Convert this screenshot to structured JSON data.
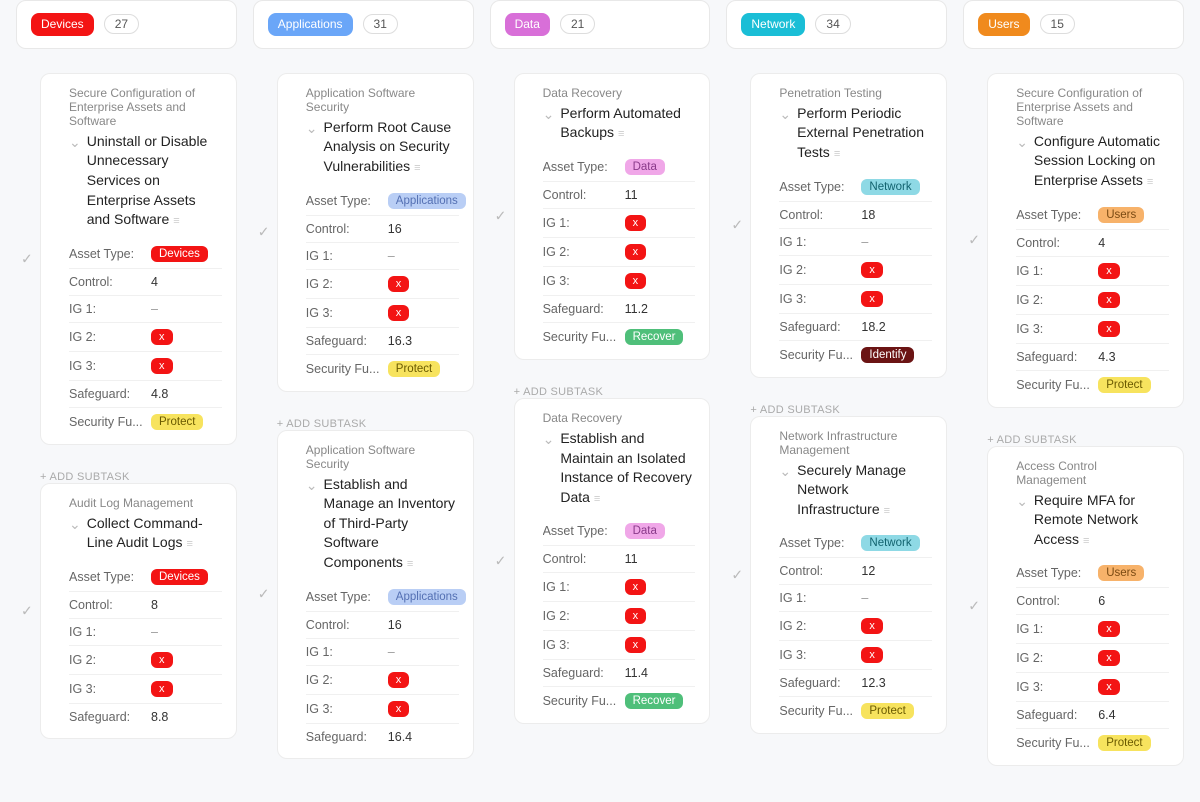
{
  "ui": {
    "add_subtask": "+ ADD SUBTASK"
  },
  "labels": {
    "asset_type": "Asset Type:",
    "control": "Control:",
    "ig1": "IG 1:",
    "ig2": "IG 2:",
    "ig3": "IG 3:",
    "safeguard": "Safeguard:",
    "security_fu": "Security Fu..."
  },
  "badge_x": "x",
  "dash": "–",
  "asset_type_colors": {
    "Devices": "t-devices",
    "Applications": "t-apps",
    "Data": "t-data",
    "Network": "t-network",
    "Users": "t-users"
  },
  "sec_fu_colors": {
    "Protect": "t-protect",
    "Recover": "t-recover",
    "Identify": "t-identify"
  },
  "columns": [
    {
      "name": "Devices",
      "count": "27",
      "bar": "c-devices",
      "pill": "c-devices",
      "cards": [
        {
          "category": "Secure Configuration of Enterprise Assets and Software",
          "title": "Uninstall or Disable Unnecessary Services on Enterprise Assets and Software",
          "asset_type": "Devices",
          "control": "4",
          "ig1": "–",
          "ig2": "x",
          "ig3": "x",
          "safeguard": "4.8",
          "sec_fu": "Protect",
          "show_add": true
        },
        {
          "category": "Audit Log Management",
          "title": "Collect Command-Line Audit Logs",
          "asset_type": "Devices",
          "control": "8",
          "ig1": "–",
          "ig2": "x",
          "ig3": "x",
          "safeguard": "8.8",
          "sec_fu": ""
        }
      ]
    },
    {
      "name": "Applications",
      "count": "31",
      "bar": "c-apps",
      "pill": "c-apps",
      "cards": [
        {
          "category": "Application Software Security",
          "title": "Perform Root Cause Analysis on Security Vulnerabilities",
          "asset_type": "Applications",
          "control": "16",
          "ig1": "–",
          "ig2": "x",
          "ig3": "x",
          "safeguard": "16.3",
          "sec_fu": "Protect",
          "show_add": true
        },
        {
          "category": "Application Software Security",
          "title": "Establish and Manage an Inventory of Third-Party Software Components",
          "asset_type": "Applications",
          "control": "16",
          "ig1": "–",
          "ig2": "x",
          "ig3": "x",
          "safeguard": "16.4",
          "sec_fu": ""
        }
      ]
    },
    {
      "name": "Data",
      "count": "21",
      "bar": "c-data",
      "pill": "c-data",
      "cards": [
        {
          "category": "Data Recovery",
          "title": "Perform Automated Backups",
          "asset_type": "Data",
          "control": "11",
          "ig1": "x",
          "ig2": "x",
          "ig3": "x",
          "safeguard": "11.2",
          "sec_fu": "Recover",
          "show_add": true
        },
        {
          "category": "Data Recovery",
          "title": "Establish and Maintain an Isolated Instance of Recovery Data",
          "asset_type": "Data",
          "control": "11",
          "ig1": "x",
          "ig2": "x",
          "ig3": "x",
          "safeguard": "11.4",
          "sec_fu": "Recover"
        }
      ]
    },
    {
      "name": "Network",
      "count": "34",
      "bar": "c-network",
      "pill": "c-network",
      "cards": [
        {
          "category": "Penetration Testing",
          "title": "Perform Periodic External Penetration Tests",
          "asset_type": "Network",
          "control": "18",
          "ig1": "–",
          "ig2": "x",
          "ig3": "x",
          "safeguard": "18.2",
          "sec_fu": "Identify",
          "show_add": true
        },
        {
          "category": "Network Infrastructure Management",
          "title": "Securely Manage Network Infrastructure",
          "asset_type": "Network",
          "control": "12",
          "ig1": "–",
          "ig2": "x",
          "ig3": "x",
          "safeguard": "12.3",
          "sec_fu": "Protect"
        }
      ]
    },
    {
      "name": "Users",
      "count": "15",
      "bar": "c-users",
      "pill": "c-users",
      "cards": [
        {
          "category": "Secure Configuration of Enterprise Assets and Software",
          "title": "Configure Automatic Session Locking on Enterprise Assets",
          "asset_type": "Users",
          "control": "4",
          "ig1": "x",
          "ig2": "x",
          "ig3": "x",
          "safeguard": "4.3",
          "sec_fu": "Protect",
          "show_add": true
        },
        {
          "category": "Access Control Management",
          "title": "Require MFA for Remote Network Access",
          "asset_type": "Users",
          "control": "6",
          "ig1": "x",
          "ig2": "x",
          "ig3": "x",
          "safeguard": "6.4",
          "sec_fu": "Protect"
        }
      ]
    }
  ]
}
